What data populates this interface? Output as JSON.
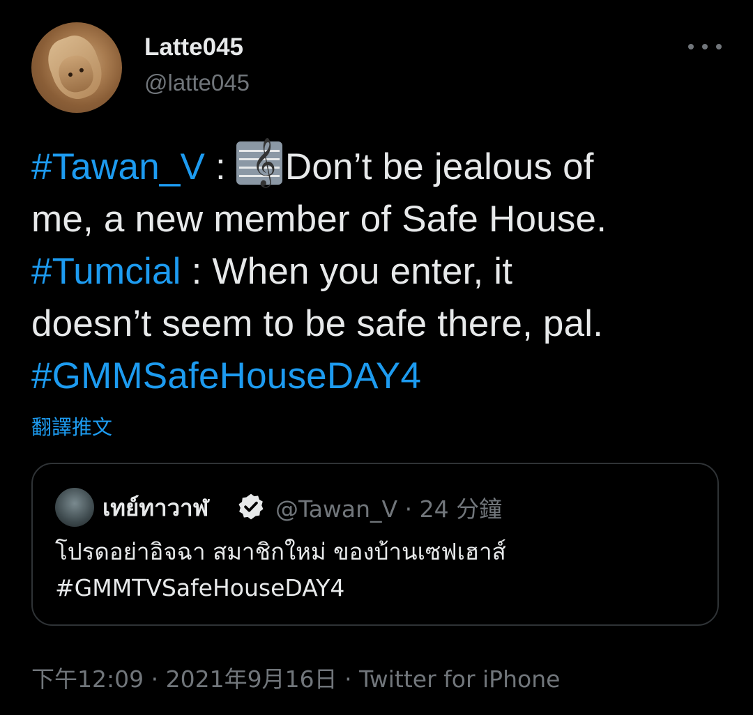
{
  "author": {
    "display_name": "Latte045",
    "handle": "@latte045"
  },
  "tweet": {
    "line1": {
      "tag": "#Tawan_V",
      "after_tag": " : ",
      "text": "Don’t be jealous of"
    },
    "line2": "me, a new member of Safe House.",
    "line3": {
      "tag": "#Tumcial",
      "text": " : When you enter, it"
    },
    "line4": "doesn’t seem to be safe there, pal.",
    "line5": {
      "tag": "#GMMSafeHouseDAY4"
    },
    "icon": "musical-score-icon"
  },
  "translate_label": "翻譯推文",
  "quoted_tweet": {
    "display_name": "เทย์ทาวาฬ",
    "verified_icon": "verified-badge-icon",
    "handle": "@Tawan_V",
    "separator": " · ",
    "time": "24 分鐘",
    "text_line1": "โปรดอย่าอิจฉา สมาชิกใหม่ ของบ้านเซฟเฮาส์",
    "text_line2": "#GMMTVSafeHouseDAY4"
  },
  "footer": {
    "time": "下午12:09",
    "sep1": " · ",
    "date": "2021年9月16日",
    "sep2": " · ",
    "source": "Twitter for iPhone"
  },
  "colors": {
    "background": "#000000",
    "text": "#e7e9ea",
    "secondary": "#71767b",
    "link": "#1d9bf0",
    "border": "#2f3336"
  }
}
